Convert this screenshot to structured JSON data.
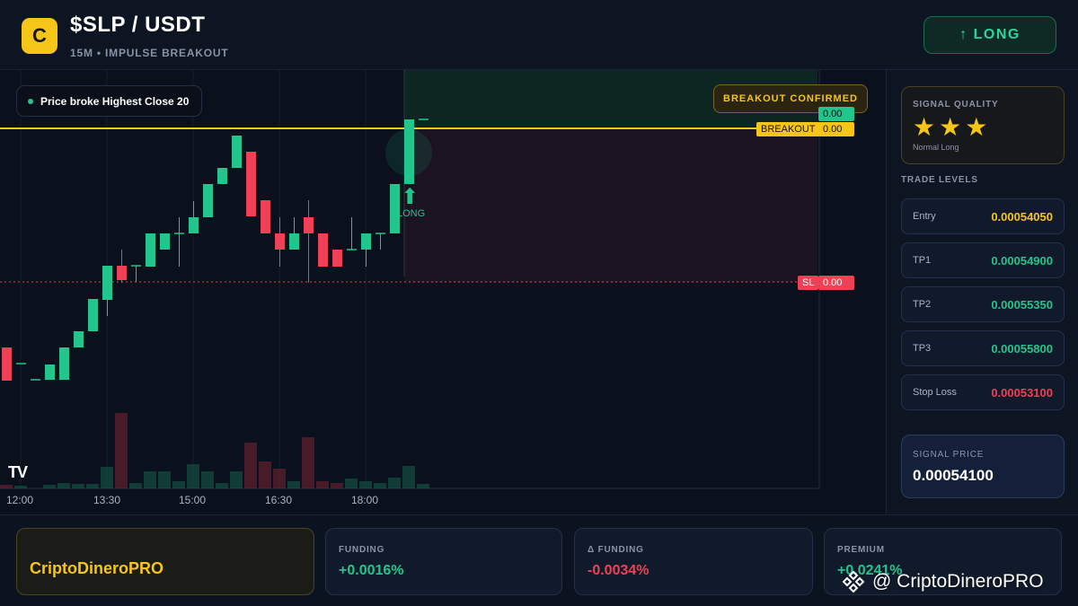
{
  "header": {
    "logo_letter": "C",
    "pair": "$SLP / USDT",
    "subtitle": "15M • IMPULSE BREAKOUT",
    "long_button": "↑ LONG"
  },
  "chart": {
    "info_pill": "Price broke Highest Close 20",
    "confirmed_badge": "BREAKOUT CONFIRMED",
    "tag_green_value": "0.00",
    "tag_breakout_label": "BREAKOUT",
    "tag_breakout_value": "0.00",
    "tag_sl_label": "SL",
    "tag_sl_value": "0.00",
    "long_marker": "LONG",
    "tv_logo": "TV",
    "x_labels": [
      "12:00",
      "13:30",
      "15:00",
      "16:30",
      "18:00"
    ],
    "colors": {
      "up": "#22c58b",
      "down": "#ef4056",
      "breakout_line": "#f5c518"
    }
  },
  "side": {
    "quality_title": "SIGNAL QUALITY",
    "quality_stars": "★★★",
    "quality_sub": "Normal Long",
    "levels_title": "TRADE LEVELS",
    "levels": [
      {
        "label": "Entry",
        "value": "0.00054050",
        "color": "#f5c518"
      },
      {
        "label": "TP1",
        "value": "0.00054900",
        "color": "#22c58b"
      },
      {
        "label": "TP2",
        "value": "0.00055350",
        "color": "#22c58b"
      },
      {
        "label": "TP3",
        "value": "0.00055800",
        "color": "#22c58b"
      },
      {
        "label": "Stop Loss",
        "value": "0.00053100",
        "color": "#ef4056"
      }
    ],
    "signal_price_title": "SIGNAL PRICE",
    "signal_price": "0.00054100"
  },
  "bottom": {
    "brand": "CriptoDineroPRO",
    "stats": [
      {
        "title": "FUNDING",
        "value": "+0.0016%",
        "color": "#22c58b"
      },
      {
        "title": "Δ FUNDING",
        "value": "-0.0034%",
        "color": "#ef4056"
      },
      {
        "title": "PREMIUM",
        "value": "+0.0241%",
        "color": "#22c58b"
      }
    ],
    "watermark": "@ CriptoDineroPRO"
  }
}
